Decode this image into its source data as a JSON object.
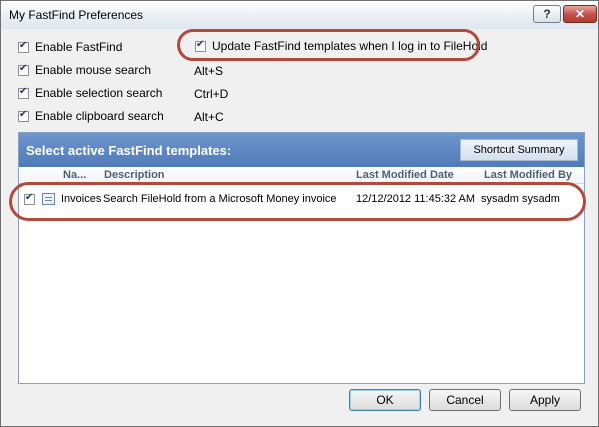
{
  "window": {
    "title": "My FastFind Preferences",
    "help_label": "?",
    "close_label": "✕"
  },
  "options": [
    {
      "label": "Enable FastFind",
      "checked": true,
      "shortcut": ""
    },
    {
      "label": "Enable mouse search",
      "checked": true,
      "shortcut": "Alt+S"
    },
    {
      "label": "Enable selection search",
      "checked": true,
      "shortcut": "Ctrl+D"
    },
    {
      "label": "Enable clipboard search",
      "checked": true,
      "shortcut": "Alt+C"
    }
  ],
  "update_option": {
    "label": "Update FastFind templates when I log in to FileHold",
    "checked": true
  },
  "templates_panel": {
    "title": "Select active FastFind templates:",
    "summary_button": "Shortcut Summary",
    "columns": [
      "Na...",
      "Description",
      "Last Modified Date",
      "Last Modified By"
    ],
    "rows": [
      {
        "checked": true,
        "icon": "template-icon",
        "name": "Invoices",
        "description": "Search FileHold from a Microsoft Money invoice",
        "modified_date": "12/12/2012 11:45:32 AM",
        "modified_by": "sysadm sysadm"
      }
    ]
  },
  "buttons": {
    "ok": "OK",
    "cancel": "Cancel",
    "apply": "Apply"
  },
  "colors": {
    "highlight_ring": "#b24a3b",
    "panel_header": "#5a84c0"
  }
}
